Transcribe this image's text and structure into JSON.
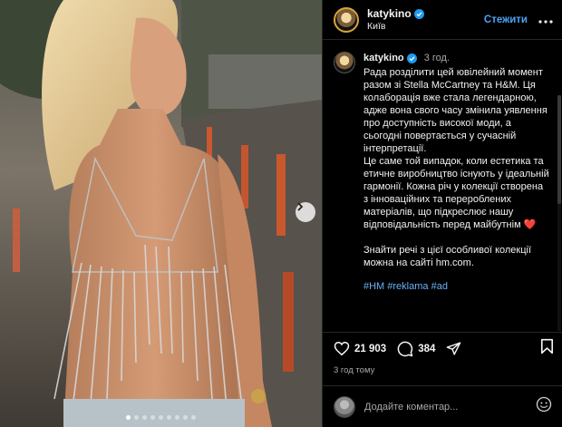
{
  "post": {
    "username": "katykino",
    "location": "Київ",
    "follow_label": "Стежити",
    "more_icon": "more-horizontal-icon",
    "verified_color": "#1d9bf0",
    "accent_color": "#4aa3f5"
  },
  "caption": {
    "username": "katykino",
    "time": "3 год.",
    "paragraphs": [
      "Рада розділити цей ювілейний момент разом зі Stella McCartney та H&M. Ця колаборація вже стала легендарною, адже вона свого часу змінила уявлення про доступність високої моди, а сьогодні повертається у сучасній інтерпретації.",
      "Це саме той випадок, коли естетика та етичне виробництво існують у ідеальній гармонії. Кожна річ у колекції створена з інноваційних та перероблених матеріалів, що підкреслює нашу відповідальність перед майбутнім ❤️",
      "",
      "Знайти речі з цієї особливої колекції можна на сайті hm.com."
    ],
    "hashtags": "#HM #reklama #ad"
  },
  "actions": {
    "likes": "21 903",
    "comments": "384",
    "time_ago": "3 год тому"
  },
  "comment": {
    "placeholder": "Додайте коментар..."
  },
  "carousel": {
    "slide_count": 9,
    "active_index": 0
  }
}
